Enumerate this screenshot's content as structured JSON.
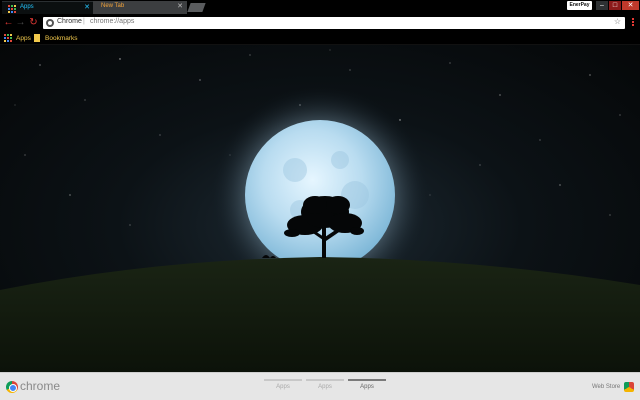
{
  "browser": {
    "tabs": [
      {
        "title": "Apps",
        "active": true
      },
      {
        "title": "New Tab",
        "active": false
      }
    ],
    "profile_name": "EnerPay",
    "window_controls": [
      "minimize",
      "maximize",
      "close"
    ]
  },
  "toolbar": {
    "omnibox_label": "Chrome",
    "omnibox_separator": "|",
    "url": "chrome://apps"
  },
  "bookmarks_bar": {
    "items": [
      {
        "label": "Apps",
        "icon": "apps-grid-icon"
      },
      {
        "label": "Bookmarks",
        "icon": "folder-icon"
      }
    ]
  },
  "wallpaper": {
    "description_icon": "moon-tree-wallpaper"
  },
  "bottom_bar": {
    "brand": "chrome",
    "pages": [
      {
        "label": "Apps",
        "active": false
      },
      {
        "label": "Apps",
        "active": false
      },
      {
        "label": "Apps",
        "active": true
      }
    ],
    "web_store_label": "Web Store"
  },
  "colors": {
    "accent_red": "#e53935",
    "active_tab_text": "#24c6ff",
    "inactive_tab_text": "#f0a23a",
    "bookmark_text": "#f2c94c"
  }
}
